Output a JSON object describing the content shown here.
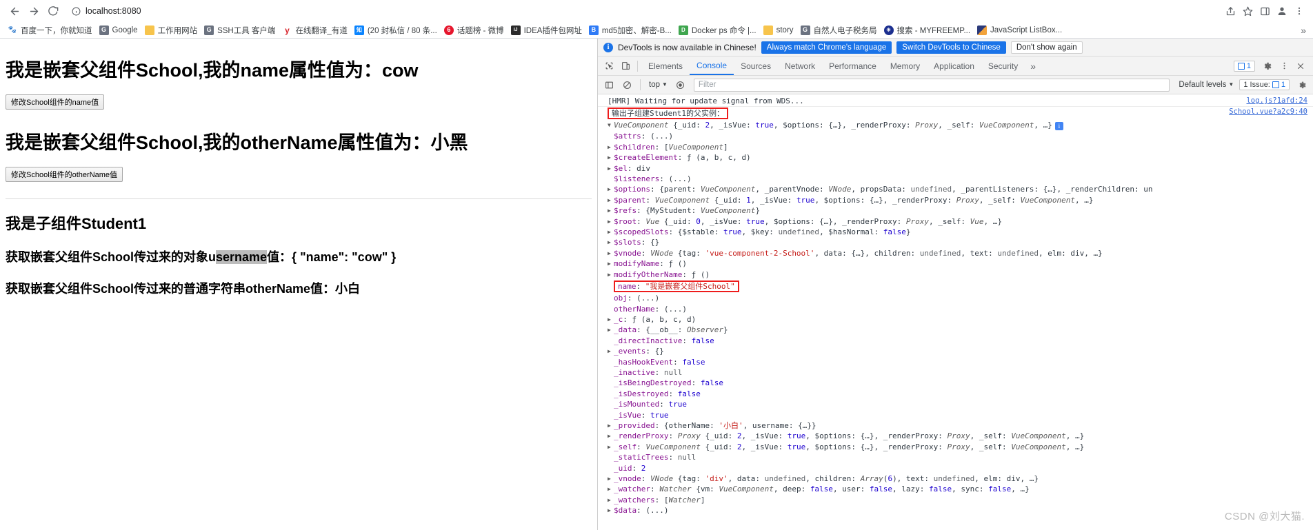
{
  "browser": {
    "back_label": "Back",
    "forward_label": "Forward",
    "reload_label": "Reload",
    "url": "localhost:8080",
    "site_info_label": "View site information",
    "share_label": "Share this page",
    "bookmark_label": "Bookmark this tab",
    "sidepanel_label": "Side panel",
    "profile_label": "Profile",
    "menu_label": "Customize and control Google Chrome",
    "bookmarks": [
      {
        "label": "百度一下，你就知道",
        "icon": "baidu-icon",
        "color": "#2e2eff",
        "glyph": "百"
      },
      {
        "label": "Google",
        "icon": "google-icon",
        "color": "#7a7a7a",
        "glyph": "G"
      },
      {
        "label": "工作用网站",
        "icon": "folder-icon",
        "color": "#f7c44c",
        "glyph": ""
      },
      {
        "label": "SSH工具 客户端",
        "icon": "globe-icon",
        "color": "#7a7a7a",
        "glyph": "G"
      },
      {
        "label": "在线翻译_有道",
        "icon": "youdao-icon",
        "color": "#ffffff",
        "glyph": "y"
      },
      {
        "label": "(20 封私信 / 80 条...",
        "icon": "zhihu-icon",
        "color": "#0a84ff",
        "glyph": "知"
      },
      {
        "label": "话题榜 - 微博",
        "icon": "weibo-icon",
        "color": "#e6162d",
        "glyph": "6"
      },
      {
        "label": "IDEA插件包网址",
        "icon": "jetbrains-icon",
        "color": "#3a3a3a",
        "glyph": "IJ"
      },
      {
        "label": "md5加密、解密-B...",
        "icon": "bejson-icon",
        "color": "#2f7bf6",
        "glyph": "B"
      },
      {
        "label": "Docker ps 命令 |...",
        "icon": "docker-icon",
        "color": "#2fa84f",
        "glyph": "D"
      },
      {
        "label": "story",
        "icon": "folder-icon",
        "color": "#f7c44c",
        "glyph": ""
      },
      {
        "label": "自然人电子税务局",
        "icon": "globe-icon",
        "color": "#7a7a7a",
        "glyph": "G"
      },
      {
        "label": "搜索 - MYFREEMP...",
        "icon": "search-globe-icon",
        "color": "#1b2f8f",
        "glyph": "@"
      },
      {
        "label": "JavaScript ListBox...",
        "icon": "windows-icon",
        "color": "#f2a33c",
        "glyph": ""
      }
    ],
    "bookmarks_overflow_label": "»"
  },
  "page": {
    "school_name_heading": "我是嵌套父组件School,我的name属性值为：cow",
    "school_name_button": "修改School组件的name值",
    "school_othername_heading": "我是嵌套父组件School,我的otherName属性值为：小黑",
    "school_othername_button": "修改School组件的otherName值",
    "student_heading": "我是子组件Student1",
    "student_line1_pre": "获取嵌套父组件School传过来的对象u",
    "student_line1_sel": "sername",
    "student_line1_post": "值：{ \"name\": \"cow\" }",
    "student_line2": "获取嵌套父组件School传过来的普通字符串otherName值：小白"
  },
  "devtools": {
    "banner": {
      "icon": "info-icon",
      "text": "DevTools is now available in Chinese!",
      "btn_always": "Always match Chrome's language",
      "btn_switch": "Switch DevTools to Chinese",
      "btn_dismiss": "Don't show again"
    },
    "tabs": [
      {
        "label": "Elements",
        "active": false
      },
      {
        "label": "Console",
        "active": true
      },
      {
        "label": "Sources",
        "active": false
      },
      {
        "label": "Network",
        "active": false
      },
      {
        "label": "Performance",
        "active": false
      },
      {
        "label": "Memory",
        "active": false
      },
      {
        "label": "Application",
        "active": false
      },
      {
        "label": "Security",
        "active": false
      }
    ],
    "tabs_more": "»",
    "inspect_label": "Inspect element",
    "device_label": "Toggle device toolbar",
    "messages_count": "1",
    "settings_label": "Settings",
    "more_label": "More options",
    "close_label": "Close DevTools",
    "filterbar": {
      "sidebar_label": "Show console sidebar",
      "clear_label": "Clear console",
      "context": "top",
      "eye_label": "Live expression",
      "filter_placeholder": "Filter",
      "levels": "Default levels",
      "issue_text": "1 Issue:",
      "issue_count": "1"
    },
    "console": {
      "rows": [
        {
          "type": "plain",
          "text": "[HMR] Waiting for update signal from WDS...",
          "source": "log.js?1afd:24"
        },
        {
          "type": "boxed",
          "text": "输出子组建Student1的父实例：",
          "source": "School.vue?a2c9:40"
        },
        {
          "type": "expand-head",
          "arrow": "▼",
          "text": "VueComponent {_uid: 2, _isVue: true, $options: {…}, _renderProxy: Proxy, _self: VueComponent, …}",
          "badge": "i"
        },
        {
          "type": "prop",
          "arrow": "",
          "name": "$attrs",
          "value": "(...)"
        },
        {
          "type": "prop",
          "arrow": "▶",
          "name": "$children",
          "value": "[VueComponent]"
        },
        {
          "type": "prop",
          "arrow": "▶",
          "name": "$createElement",
          "value": "ƒ (a, b, c, d)"
        },
        {
          "type": "prop",
          "arrow": "▶",
          "name": "$el",
          "value": "div"
        },
        {
          "type": "prop",
          "arrow": "",
          "name": "$listeners",
          "value": "(...)"
        },
        {
          "type": "prop",
          "arrow": "▶",
          "name": "$options",
          "value": "{parent: VueComponent, _parentVnode: VNode, propsData: undefined, _parentListeners: {…}, _renderChildren: un"
        },
        {
          "type": "prop",
          "arrow": "▶",
          "name": "$parent",
          "value": "VueComponent {_uid: 1, _isVue: true, $options: {…}, _renderProxy: Proxy, _self: VueComponent, …}"
        },
        {
          "type": "prop",
          "arrow": "▶",
          "name": "$refs",
          "value": "{MyStudent: VueComponent}"
        },
        {
          "type": "prop",
          "arrow": "▶",
          "name": "$root",
          "value": "Vue {_uid: 0, _isVue: true, $options: {…}, _renderProxy: Proxy, _self: Vue, …}"
        },
        {
          "type": "prop",
          "arrow": "▶",
          "name": "$scopedSlots",
          "value": "{$stable: true, $key: undefined, $hasNormal: false}"
        },
        {
          "type": "prop",
          "arrow": "▶",
          "name": "$slots",
          "value": "{}"
        },
        {
          "type": "prop",
          "arrow": "▶",
          "name": "$vnode",
          "value": "VNode {tag: 'vue-component-2-School', data: {…}, children: undefined, text: undefined, elm: div, …}"
        },
        {
          "type": "prop",
          "arrow": "▶",
          "name": "modifyName",
          "value": "ƒ ()"
        },
        {
          "type": "prop",
          "arrow": "▶",
          "name": "modifyOtherName",
          "value": "ƒ ()"
        },
        {
          "type": "prop-boxed",
          "arrow": "",
          "name": "name",
          "value": "\"我是嵌套父组件School\""
        },
        {
          "type": "prop",
          "arrow": "",
          "name": "obj",
          "value": "(...)"
        },
        {
          "type": "prop",
          "arrow": "",
          "name": "otherName",
          "value": "(...)"
        },
        {
          "type": "prop",
          "arrow": "▶",
          "name": "_c",
          "value": "ƒ (a, b, c, d)"
        },
        {
          "type": "prop",
          "arrow": "▶",
          "name": "_data",
          "value": "{__ob__: Observer}"
        },
        {
          "type": "prop",
          "arrow": "",
          "name": "_directInactive",
          "value": "false"
        },
        {
          "type": "prop",
          "arrow": "▶",
          "name": "_events",
          "value": "{}"
        },
        {
          "type": "prop",
          "arrow": "",
          "name": "_hasHookEvent",
          "value": "false"
        },
        {
          "type": "prop",
          "arrow": "",
          "name": "_inactive",
          "value": "null"
        },
        {
          "type": "prop",
          "arrow": "",
          "name": "_isBeingDestroyed",
          "value": "false"
        },
        {
          "type": "prop",
          "arrow": "",
          "name": "_isDestroyed",
          "value": "false"
        },
        {
          "type": "prop",
          "arrow": "",
          "name": "_isMounted",
          "value": "true"
        },
        {
          "type": "prop",
          "arrow": "",
          "name": "_isVue",
          "value": "true"
        },
        {
          "type": "prop",
          "arrow": "▶",
          "name": "_provided",
          "value": "{otherName: '小白', username: {…}}"
        },
        {
          "type": "prop",
          "arrow": "▶",
          "name": "_renderProxy",
          "value": "Proxy {_uid: 2, _isVue: true, $options: {…}, _renderProxy: Proxy, _self: VueComponent, …}"
        },
        {
          "type": "prop",
          "arrow": "▶",
          "name": "_self",
          "value": "VueComponent {_uid: 2, _isVue: true, $options: {…}, _renderProxy: Proxy, _self: VueComponent, …}"
        },
        {
          "type": "prop",
          "arrow": "",
          "name": "_staticTrees",
          "value": "null"
        },
        {
          "type": "prop",
          "arrow": "",
          "name": "_uid",
          "value": "2"
        },
        {
          "type": "prop",
          "arrow": "▶",
          "name": "_vnode",
          "value": "VNode {tag: 'div', data: undefined, children: Array(6), text: undefined, elm: div, …}"
        },
        {
          "type": "prop",
          "arrow": "▶",
          "name": "_watcher",
          "value": "Watcher {vm: VueComponent, deep: false, user: false, lazy: false, sync: false, …}"
        },
        {
          "type": "prop",
          "arrow": "▶",
          "name": "_watchers",
          "value": "[Watcher]"
        },
        {
          "type": "prop",
          "arrow": "▶",
          "name": "$data",
          "value": "(...)"
        }
      ]
    },
    "watermark": "CSDN @刘大猫."
  }
}
